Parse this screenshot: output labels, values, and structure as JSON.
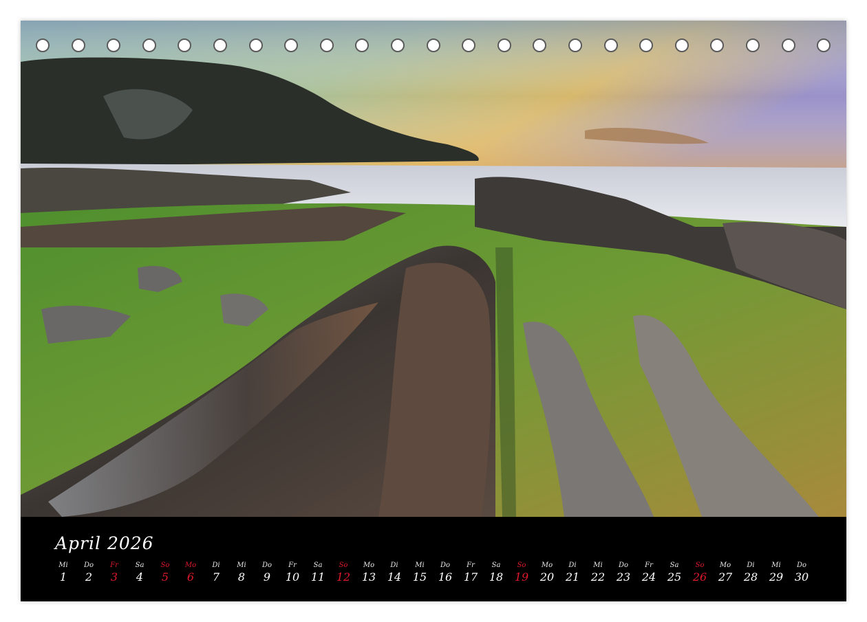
{
  "calendar": {
    "month_label": "April 2026",
    "days": [
      {
        "name": "Mi",
        "num": "1",
        "holiday": false
      },
      {
        "name": "Do",
        "num": "2",
        "holiday": false
      },
      {
        "name": "Fr",
        "num": "3",
        "holiday": true
      },
      {
        "name": "Sa",
        "num": "4",
        "holiday": false
      },
      {
        "name": "So",
        "num": "5",
        "holiday": true
      },
      {
        "name": "Mo",
        "num": "6",
        "holiday": true
      },
      {
        "name": "Di",
        "num": "7",
        "holiday": false
      },
      {
        "name": "Mi",
        "num": "8",
        "holiday": false
      },
      {
        "name": "Do",
        "num": "9",
        "holiday": false
      },
      {
        "name": "Fr",
        "num": "10",
        "holiday": false
      },
      {
        "name": "Sa",
        "num": "11",
        "holiday": false
      },
      {
        "name": "So",
        "num": "12",
        "holiday": true
      },
      {
        "name": "Mo",
        "num": "13",
        "holiday": false
      },
      {
        "name": "Di",
        "num": "14",
        "holiday": false
      },
      {
        "name": "Mi",
        "num": "15",
        "holiday": false
      },
      {
        "name": "Do",
        "num": "16",
        "holiday": false
      },
      {
        "name": "Fr",
        "num": "17",
        "holiday": false
      },
      {
        "name": "Sa",
        "num": "18",
        "holiday": false
      },
      {
        "name": "So",
        "num": "19",
        "holiday": true
      },
      {
        "name": "Mo",
        "num": "20",
        "holiday": false
      },
      {
        "name": "Di",
        "num": "21",
        "holiday": false
      },
      {
        "name": "Mi",
        "num": "22",
        "holiday": false
      },
      {
        "name": "Do",
        "num": "23",
        "holiday": false
      },
      {
        "name": "Fr",
        "num": "24",
        "holiday": false
      },
      {
        "name": "Sa",
        "num": "25",
        "holiday": false
      },
      {
        "name": "So",
        "num": "26",
        "holiday": true
      },
      {
        "name": "Mo",
        "num": "27",
        "holiday": false
      },
      {
        "name": "Di",
        "num": "28",
        "holiday": false
      },
      {
        "name": "Mi",
        "num": "29",
        "holiday": false
      },
      {
        "name": "Do",
        "num": "30",
        "holiday": false
      }
    ]
  },
  "binding": {
    "hole_count": 23
  },
  "colors": {
    "holiday": "#e0192b",
    "bar": "#000000",
    "text": "#ffffff"
  }
}
